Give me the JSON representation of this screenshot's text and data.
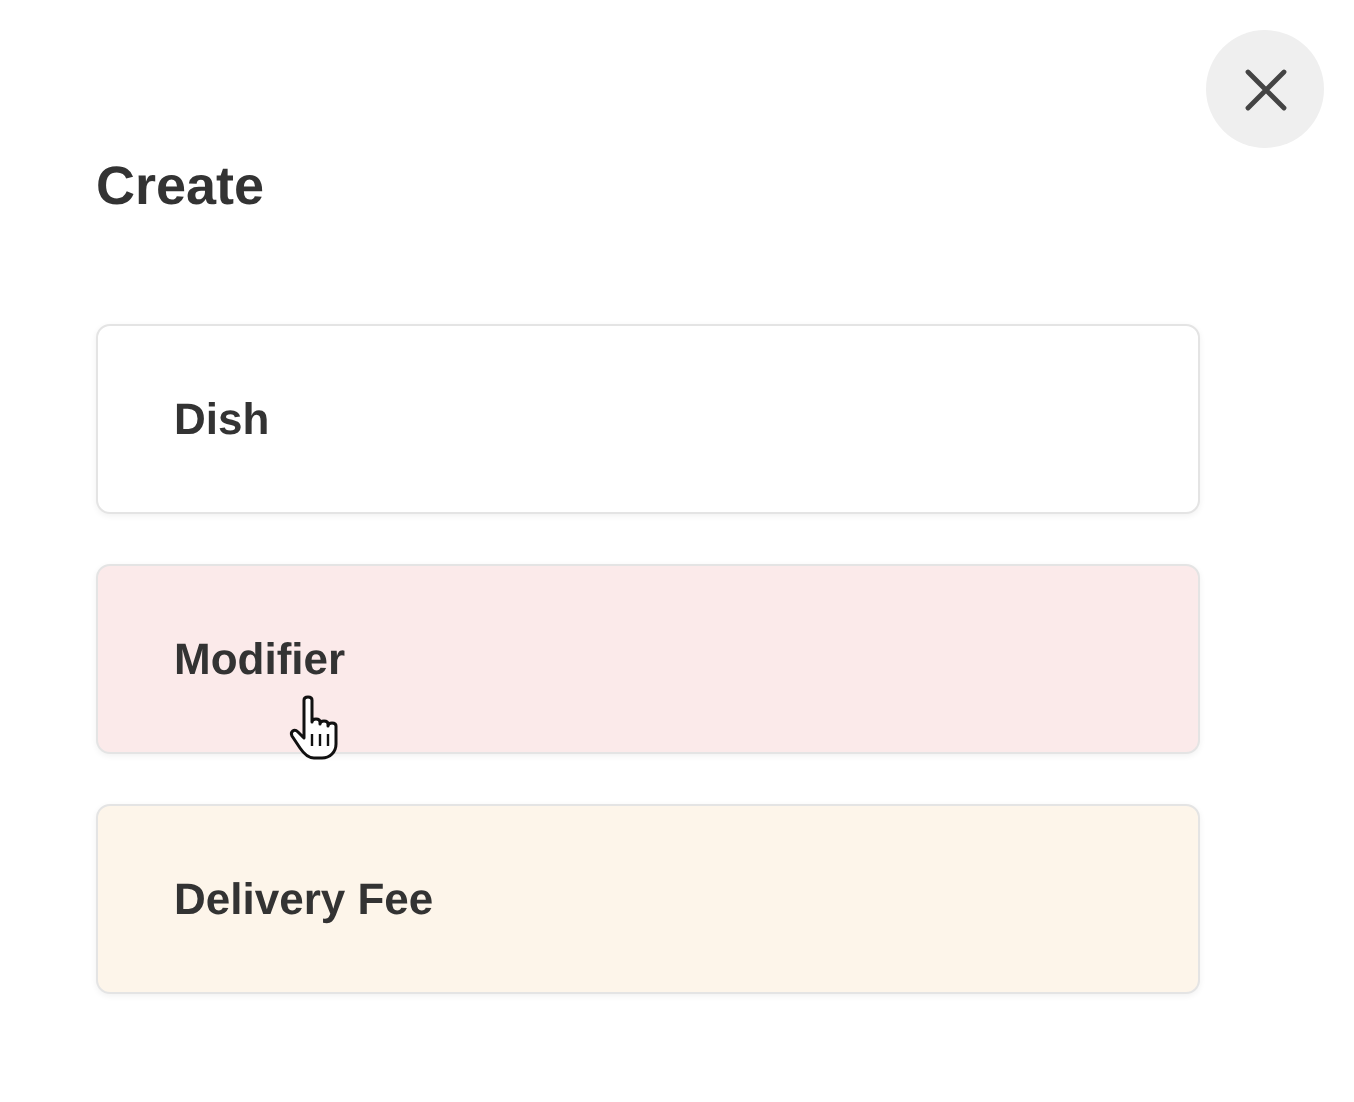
{
  "title": "Create",
  "options": [
    {
      "label": "Dish",
      "color": "#ffffff",
      "hovered": false
    },
    {
      "label": "Modifier",
      "color": "#fbeaea",
      "hovered": true
    },
    {
      "label": "Delivery Fee",
      "color": "#fdf5ea",
      "hovered": false
    }
  ]
}
